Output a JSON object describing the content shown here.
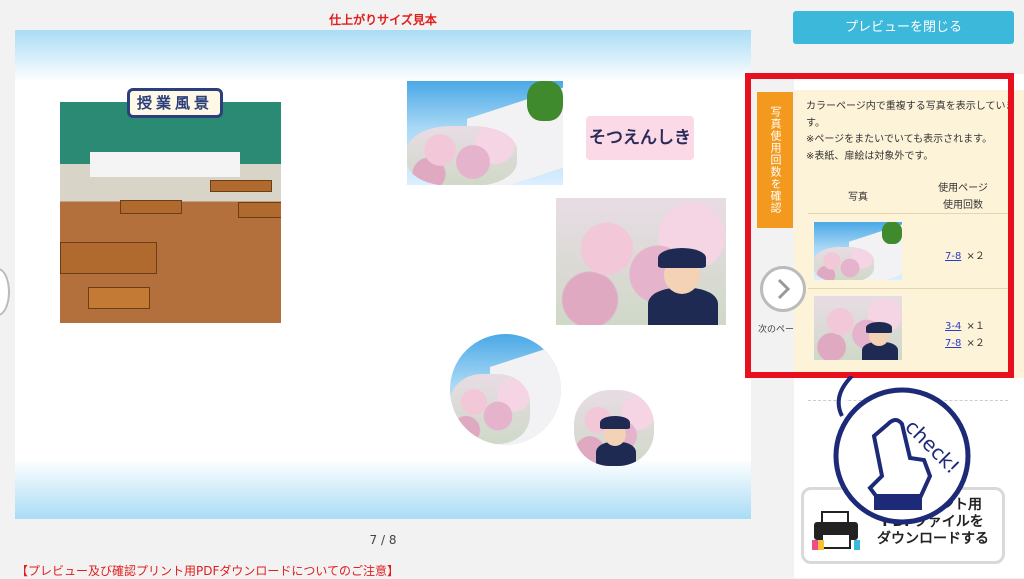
{
  "header": {
    "size_label": "仕上がりサイズ見本"
  },
  "spread": {
    "classroom_title": "授業風景",
    "graduation_title": "そつえんしき"
  },
  "pager": {
    "text": "7 / 8"
  },
  "notice": {
    "text": "【プレビュー及び確認プリント用PDFダウンロードについてのご注意】"
  },
  "sidebar": {
    "close_button": "プレビューを閉じる",
    "tab_label": "写真使用回数を確認",
    "info_lines": [
      "カラーページ内で重複する写真を表示しています。",
      "※ページをまたいでいても表示されます。",
      "※表紙、扉絵は対象外です。"
    ],
    "table": {
      "col_photo": "写真",
      "col_usage_1": "使用ページ",
      "col_usage_2": "使用回数",
      "rows": [
        {
          "thumb": "school-blossom-photo",
          "usages": [
            {
              "page": "7-8",
              "count": "×２"
            }
          ]
        },
        {
          "thumb": "girl-blossom-photo",
          "usages": [
            {
              "page": "3-4",
              "count": "×１"
            },
            {
              "page": "7-8",
              "count": "×２"
            }
          ]
        }
      ]
    },
    "next_label": "次のペー",
    "pdf_button": "確認プリント用\nPDFファイルを\nダウンロードする",
    "check_text": "check!"
  },
  "colors": {
    "accent_blue": "#3cb8db",
    "tab_orange": "#f39a1e",
    "highlight_red": "#e80f1e",
    "notice_red": "#e11d1d"
  }
}
